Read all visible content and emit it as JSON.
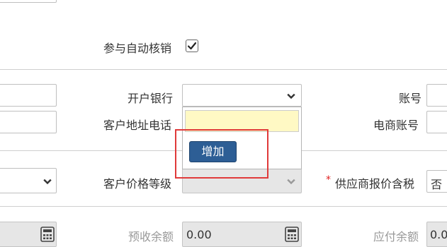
{
  "form": {
    "auto_writeoff_label": "参与自动核销",
    "auto_writeoff_checked": true,
    "bank_label": "开户银行",
    "bank_value": "",
    "account_label": "账号",
    "customer_address_phone_label": "客户地址电话",
    "ecommerce_account_label": "电商账号",
    "customer_price_level_label": "客户价格等级",
    "supplier_price_tax_required_mark": "*",
    "supplier_price_tax_label": "供应商报价含税",
    "supplier_price_tax_value": "否",
    "advance_receipt_balance_label": "预收余额",
    "advance_receipt_balance_value": "0.00",
    "payable_balance_label": "应付余额",
    "payable_balance_value": "0.0"
  },
  "dropdown": {
    "add_button_label": "增加"
  },
  "colors": {
    "accent_button": "#2d5e95",
    "highlight_box": "#e03a3a",
    "input_focus_bg": "#fff9c4",
    "readonly_bg": "#e6e6e6"
  }
}
